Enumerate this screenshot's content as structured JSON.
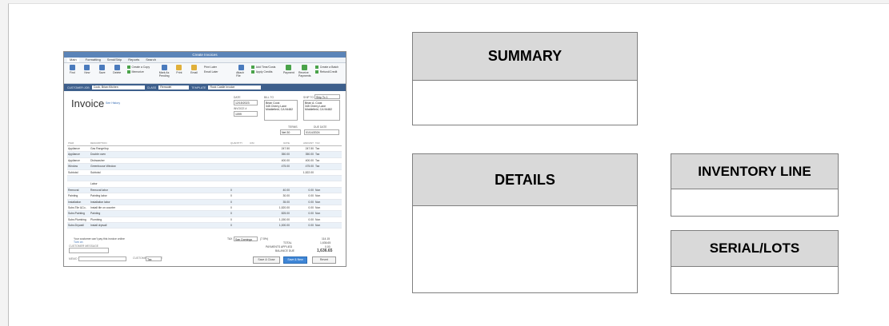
{
  "boxes": {
    "summary": "SUMMARY",
    "details": "DETAILS",
    "inventory_line": "INVENTORY LINE",
    "serial_lots": "SERIAL/LOTS"
  },
  "invoice": {
    "window_title": "Create Invoices",
    "tabs": [
      "Main",
      "Formatting",
      "Send/Ship",
      "Reports",
      "Search"
    ],
    "ribbon": [
      "Find",
      "New",
      "Save",
      "Delete",
      "Create a Copy",
      "Memorize",
      "Mark As Pending",
      "Print",
      "Email",
      "Print Later",
      "Email Later",
      "Attach File",
      "Add Time/Costs",
      "Apply Credits",
      "Payment",
      "Receive Payments",
      "Create a Batch",
      "Refund/Credit"
    ],
    "customer_job_label": "CUSTOMER:JOB",
    "customer_job": "Cook, Brian:Kitchen",
    "class_label": "CLASS",
    "class_value": "Remodel",
    "template_label": "TEMPLATE",
    "template_value": "Rock Castle Invoice",
    "title": "Invoice",
    "history_link": "See History",
    "date_label": "DATE",
    "date": "12/15/2023",
    "invoice_no_label": "INVOICE #",
    "invoice_no": "1099",
    "bill_to_label": "BILL TO",
    "bill_to": [
      "Brian Cook",
      "345 Cherry Lane",
      "Middlefield, CA 94482"
    ],
    "ship_to_label": "SHIP TO",
    "ship_to_select": "Ship To 1",
    "ship_to": [
      "Brian A. Cook",
      "345 Cherry Lane",
      "Middlefield, CA 94482"
    ],
    "terms_label": "TERMS",
    "terms": "Net 30",
    "due_label": "DUE DATE",
    "due": "01/14/2024",
    "columns": [
      "ITEM",
      "DESCRIPTION",
      "QUANTITY",
      "U/M",
      "RATE",
      "AMOUNT",
      "TAX"
    ],
    "rows": [
      [
        "Appliance",
        "Gas Range/top",
        "",
        "",
        "247.50",
        "247.50",
        "Tax"
      ],
      [
        "Appliance",
        "Double oven",
        "",
        "",
        "350.00",
        "350.00",
        "Tax"
      ],
      [
        "Appliance",
        "Dishwasher",
        "",
        "",
        "400.00",
        "400.00",
        "Tax"
      ],
      [
        "Window",
        "Greenhouse Window",
        "",
        "",
        "475.00",
        "475.00",
        "Tax"
      ],
      [
        "Subtotal",
        "Subtotal",
        "",
        "",
        "",
        "1,522.00",
        ""
      ],
      [
        "",
        "",
        "",
        "",
        "",
        "",
        ""
      ],
      [
        "",
        "Labor",
        "",
        "",
        "",
        "",
        ""
      ],
      [
        "Removal",
        "Removal labor",
        "0",
        "",
        "40.00",
        "0.00",
        "Non"
      ],
      [
        "Painting",
        "Painting labor",
        "0",
        "",
        "30.00",
        "0.00",
        "Non"
      ],
      [
        "Installation",
        "Installation labor",
        "0",
        "",
        "35.00",
        "0.00",
        "Non"
      ],
      [
        "Subs:Tile &Co..",
        "Install tile on counter",
        "0",
        "",
        "1,520.00",
        "0.00",
        "Non"
      ],
      [
        "Subs:Painting",
        "Painting",
        "0",
        "",
        "825.00",
        "0.00",
        "Non"
      ],
      [
        "Subs:Plumbing",
        "Plumbing",
        "0",
        "",
        "1,150.00",
        "0.00",
        "Non"
      ],
      [
        "Subs:Drywall",
        "Install drywall",
        "0",
        "",
        "1,000.00",
        "0.00",
        "Non"
      ]
    ],
    "online_msg": "Your customer can't pay this invoice online",
    "turn_on": "Turn on",
    "customer_message_label": "CUSTOMER MESSAGE",
    "memo_label": "MEMO",
    "tax_label": "TAX",
    "tax_select": "San Domingo",
    "tax_rate": "(7.5%)",
    "tax_amount": "114.15",
    "total_label": "TOTAL",
    "total": "1,636.65",
    "payments_label": "PAYMENTS APPLIED",
    "payments": "0.00",
    "balance_label": "BALANCE DUE",
    "balance": "1,636.65",
    "cust_tax_label": "CUSTOMER TAX CODE",
    "cust_tax": "Tax",
    "save_close": "Save & Close",
    "save_new": "Save & New",
    "revert": "Revert"
  }
}
